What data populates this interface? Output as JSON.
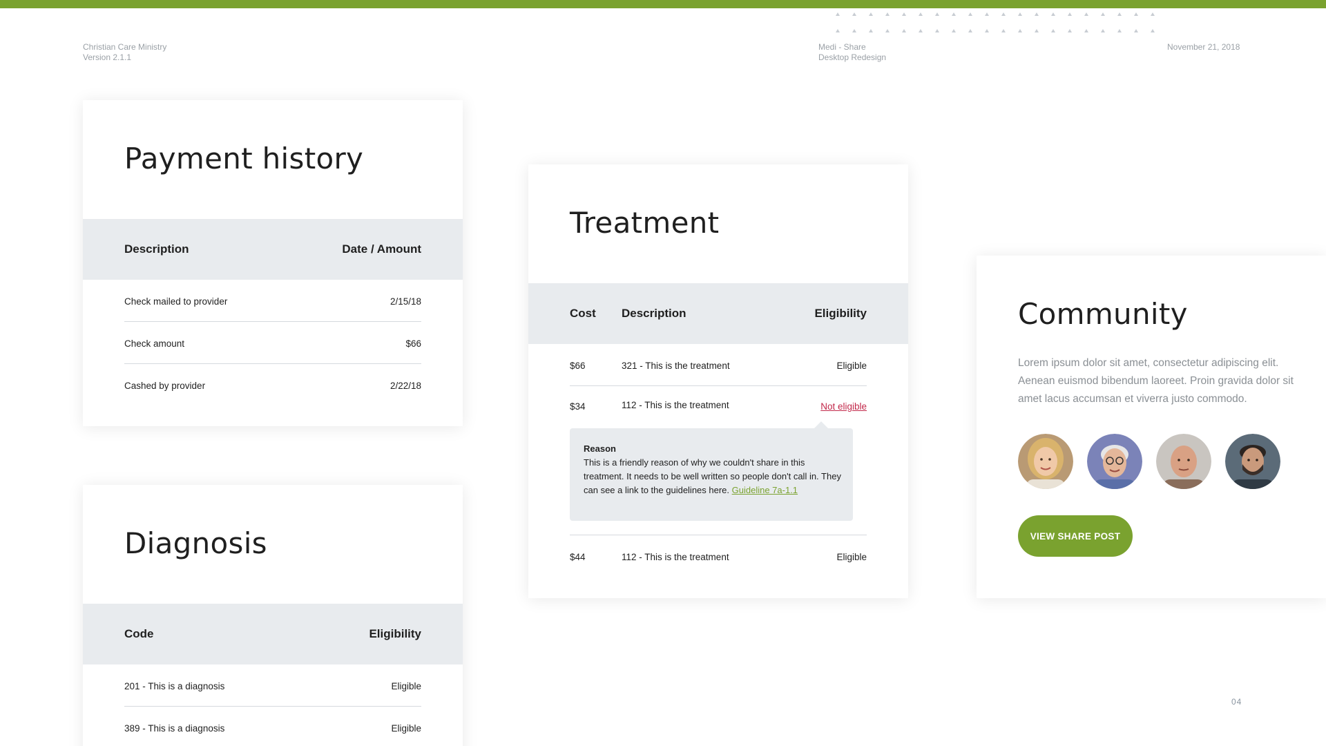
{
  "header": {
    "left": {
      "line1": "Christian Care Ministry",
      "line2": "Version 2.1.1"
    },
    "center": {
      "line1": "Medi - Share",
      "line2": "Desktop Redesign"
    },
    "date": "November 21, 2018"
  },
  "payment_history": {
    "title": "Payment history",
    "headers": {
      "description": "Description",
      "date_amount": "Date / Amount"
    },
    "rows": [
      {
        "description": "Check mailed to provider",
        "value": "2/15/18"
      },
      {
        "description": "Check amount",
        "value": "$66"
      },
      {
        "description": "Cashed by provider",
        "value": "2/22/18"
      }
    ]
  },
  "diagnosis": {
    "title": "Diagnosis",
    "headers": {
      "code": "Code",
      "eligibility": "Eligibility"
    },
    "rows": [
      {
        "code": "201 - This is a diagnosis",
        "eligibility": "Eligible"
      },
      {
        "code": "389 - This is a diagnosis",
        "eligibility": "Eligible"
      }
    ]
  },
  "treatment": {
    "title": "Treatment",
    "headers": {
      "cost": "Cost",
      "description": "Description",
      "eligibility": "Eligibility"
    },
    "rows": [
      {
        "cost": "$66",
        "description": "321 - This is the treatment",
        "eligibility": "Eligible"
      },
      {
        "cost": "$34",
        "description": "112 - This is the treatment",
        "eligibility": "Not eligible"
      },
      {
        "cost": "$44",
        "description": "112 - This is the treatment",
        "eligibility": "Eligible"
      }
    ],
    "reason": {
      "title": "Reason",
      "text": "This is a friendly reason of why we couldn't share in this treatment. It needs to be well written so people don't call in. They can see a link to the guidelines here. ",
      "link": "Guideline 7a-1.1"
    }
  },
  "community": {
    "title": "Community",
    "text": "Lorem ipsum dolor sit amet, consectetur adipiscing elit. Aenean euismod bibendum laoreet. Proin gravida dolor sit amet lacus accumsan et viverra justo commodo.",
    "avatars": [
      "avatar-woman-blonde",
      "avatar-older-man-glasses",
      "avatar-older-man-bald",
      "avatar-young-man-beard"
    ],
    "button": "VIEW SHARE POST"
  },
  "page_number": "04",
  "colors": {
    "accent": "#7aa22f",
    "error": "#c2284a",
    "table_header_bg": "#e8ebee"
  }
}
